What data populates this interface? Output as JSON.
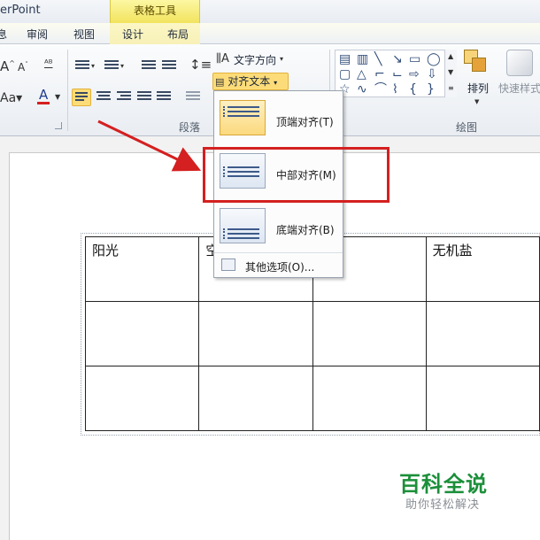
{
  "app": {
    "title": "erPoint",
    "context_group": "表格工具"
  },
  "tabs": [
    "审阅",
    "视图",
    "设计",
    "布局"
  ],
  "tab_stub": "息",
  "ribbon": {
    "paragraph_label": "段落",
    "drawing_label": "绘图",
    "text_direction": "文字方向",
    "align_text": "对齐文本",
    "arrange": "排列",
    "quick_styles": "快速样式"
  },
  "menu": {
    "items": [
      {
        "label": "顶端对齐(T)",
        "mnemonic": "T"
      },
      {
        "label": "中部对齐(M)",
        "mnemonic": "M"
      },
      {
        "label": "底端对齐(B)",
        "mnemonic": "B"
      }
    ],
    "more_options": "其他选项(O)..."
  },
  "table": {
    "rows": [
      [
        "阳光",
        "空",
        "",
        "无机盐"
      ],
      [
        "",
        "",
        "",
        ""
      ],
      [
        "",
        "",
        "",
        ""
      ]
    ]
  },
  "watermark": {
    "title": "百科全说",
    "subtitle": "助你轻松解决"
  },
  "colors": {
    "accent_red": "#d42020",
    "selected_yellow": "#fcdc79",
    "watermark_green": "#1b8f3a"
  }
}
